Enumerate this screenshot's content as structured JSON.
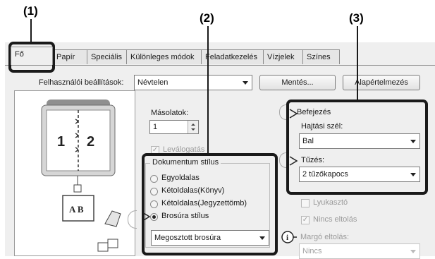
{
  "callouts": [
    "(1)",
    "(2)",
    "(3)"
  ],
  "tabs": [
    {
      "label": "Fő",
      "active": true
    },
    {
      "label": "Papír"
    },
    {
      "label": "Speciális"
    },
    {
      "label": "Különleges módok"
    },
    {
      "label": "Feladatkezelés"
    },
    {
      "label": "Vízjelek"
    },
    {
      "label": "Színes"
    }
  ],
  "user_settings": {
    "label": "Felhasználói beállítások:",
    "value": "Névtelen",
    "save_label": "Mentés...",
    "default_label": "Alapértelmezés"
  },
  "preview": {
    "page_left": "1",
    "page_right": "2",
    "booklet_icon_text": "A B"
  },
  "copies": {
    "label": "Másolatok:",
    "value": "1",
    "collate_label": "Leválogatás"
  },
  "document_style": {
    "title": "Dokumentum stílus",
    "options": [
      "Egyoldalas",
      "Kétoldalas(Könyv)",
      "Kétoldalas(Jegyzettömb)",
      "Brosúra stílus"
    ],
    "selected_index": 3,
    "booklet_select": "Megosztott brosúra"
  },
  "finishing": {
    "title": "Befejezés",
    "binding_label": "Hajtási szél:",
    "binding_value": "Bal",
    "staple_label": "Tűzés:",
    "staple_value": "2 tűzőkapocs",
    "punch_label": "Lyukasztó",
    "no_offset_label": "Nincs eltolás",
    "margin_shift_label": "Margó eltolás:",
    "margin_shift_value": "Nincs"
  }
}
